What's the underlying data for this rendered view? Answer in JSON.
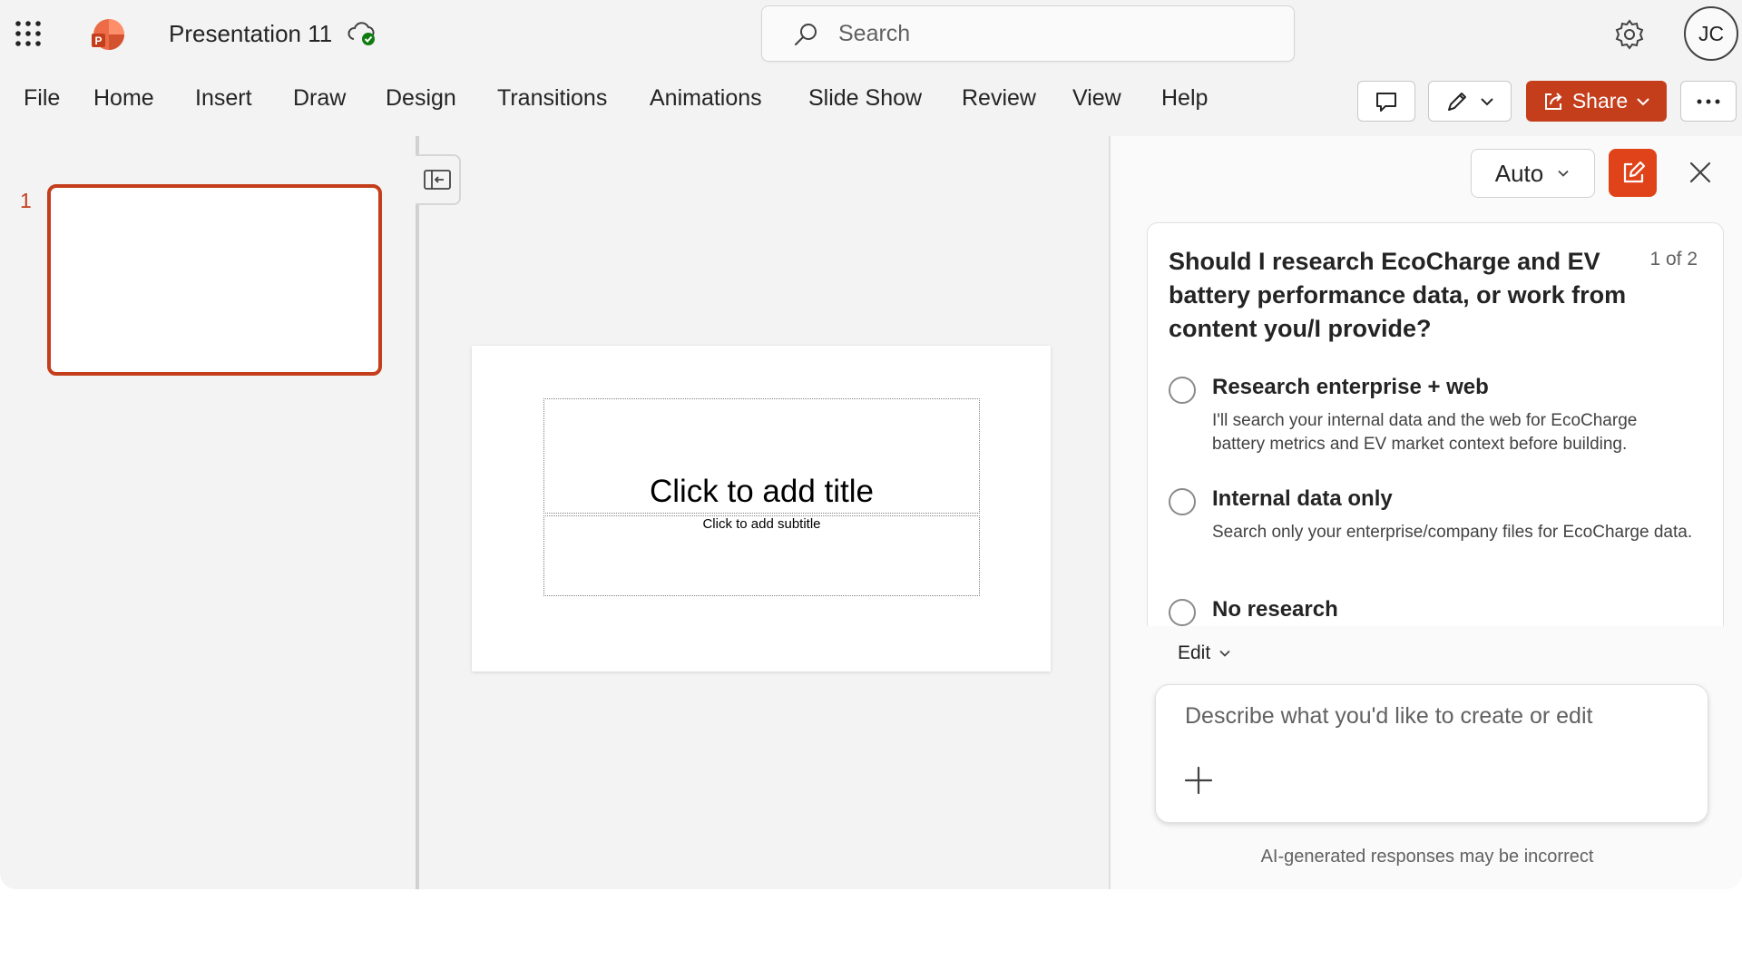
{
  "app": {
    "document_title": "Presentation 11",
    "user_initials": "JC"
  },
  "search": {
    "placeholder": "Search",
    "value": ""
  },
  "ribbon": {
    "tabs": [
      "File",
      "Home",
      "Insert",
      "Draw",
      "Design",
      "Transitions",
      "Animations",
      "Slide Show",
      "Review",
      "View",
      "Help"
    ],
    "share_label": "Share"
  },
  "thumbnails": {
    "slide_number": "1"
  },
  "slide": {
    "title_placeholder": "Click to add title",
    "subtitle_placeholder": "Click to add subtitle"
  },
  "copilot": {
    "mode_label": "Auto",
    "question": "Should I research EcoCharge and EV battery performance data, or work from content you/I provide?",
    "question_counter": "1 of 2",
    "options": [
      {
        "title": "Research enterprise + web",
        "description": "I'll search your internal data and the web for EcoCharge battery metrics and EV market context before building."
      },
      {
        "title": "Internal data only",
        "description": "Search only your enterprise/company files for EcoCharge data."
      },
      {
        "title": "No research",
        "description": ""
      }
    ],
    "edit_label": "Edit",
    "composer_placeholder": "Describe what you'd like to create or edit",
    "disclaimer": "AI-generated responses may be incorrect"
  },
  "colors": {
    "accent": "#c43e1c",
    "copilot_button": "#e0431a",
    "sync_ok": "#107c10"
  },
  "icons": [
    "app-launcher-icon",
    "powerpoint-logo-icon",
    "cloud-saved-icon",
    "search-icon",
    "settings-gear-icon",
    "comment-icon",
    "pen-icon",
    "chevron-down-icon",
    "share-icon",
    "more-icon",
    "collapse-pane-icon",
    "new-chat-icon",
    "close-icon",
    "plus-icon"
  ]
}
